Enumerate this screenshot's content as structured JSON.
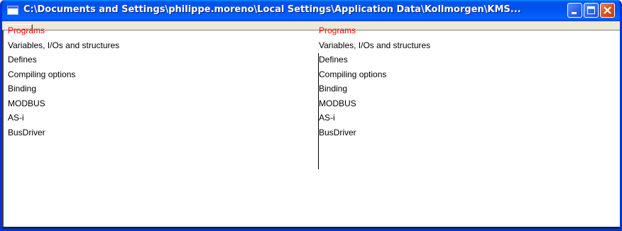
{
  "window": {
    "title": "C:\\Documents and Settings\\philippe.moreno\\Local Settings\\Application Data\\Kollmorgen\\KMS...",
    "controls": [
      "minimize",
      "maximize",
      "close"
    ]
  },
  "toolbar": {
    "back_label": "<<"
  },
  "left_pane": {
    "items": [
      {
        "label": "Programs"
      },
      {
        "label": "Variables, I/Os and structures"
      },
      {
        "label": "Defines"
      },
      {
        "label": "Compiling options"
      },
      {
        "label": "Binding"
      },
      {
        "label": "MODBUS"
      },
      {
        "label": "AS-i"
      },
      {
        "label": "BusDriver"
      }
    ]
  },
  "right_pane": {
    "items": [
      {
        "label": "Programs"
      },
      {
        "label": "Variables, I/Os and structures"
      },
      {
        "label": "Defines"
      },
      {
        "label": "Compiling options"
      },
      {
        "label": "Binding"
      },
      {
        "label": "MODBUS"
      },
      {
        "label": "AS-i"
      },
      {
        "label": "BusDriver"
      }
    ]
  },
  "colors": {
    "active_item": "#ff0000",
    "title_bar": "#0050ee"
  }
}
